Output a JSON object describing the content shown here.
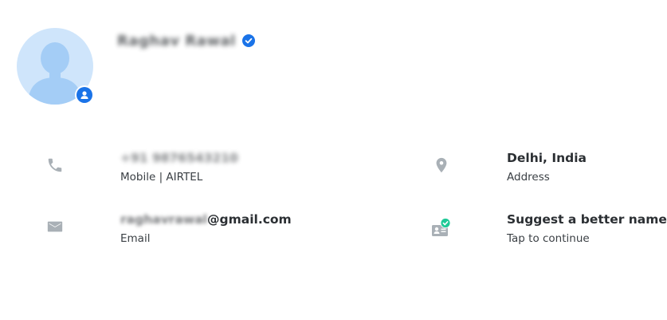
{
  "profile": {
    "name": "Raghav Rawal",
    "verified": true,
    "colors": {
      "avatar_bg": "#cfe5fb",
      "avatar_figure": "#a4cdf6",
      "badge_blue": "#1a73e8",
      "verified_blue": "#1a73e8",
      "check_green": "#20c997",
      "icon_gray": "#a9b0b6"
    }
  },
  "phone": {
    "icon": "phone-icon",
    "number": "+91 9876543210",
    "label": "Mobile | AIRTEL"
  },
  "email": {
    "icon": "mail-icon",
    "local": "raghavrawal",
    "domain": "@gmail.com",
    "label": "Email"
  },
  "address": {
    "icon": "location-pin-icon",
    "value": "Delhi, India",
    "label": "Address"
  },
  "suggest": {
    "icon": "id-card-check-icon",
    "title": "Suggest a better name",
    "subtitle": "Tap to continue"
  }
}
